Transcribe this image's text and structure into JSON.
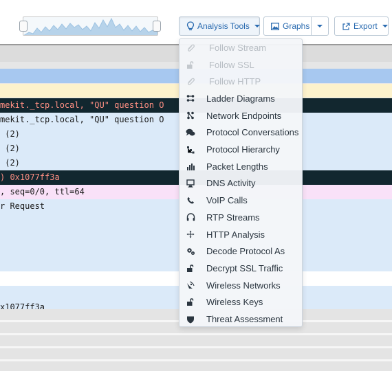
{
  "toolbar": {
    "analysis_label": "Analysis Tools",
    "graphs_label": "Graphs",
    "export_label": "Export"
  },
  "packet_rows": [
    {
      "text": "",
      "bg": "#a7c8f0",
      "color": "#1b1b1b"
    },
    {
      "text": "",
      "bg": "#fdf2cc",
      "color": "#1b1b1b"
    },
    {
      "text": "mekit._tcp.local, \"QU\" question O",
      "bg": "#12272f",
      "color": "#ff8f83"
    },
    {
      "text": "mekit._tcp.local, \"QU\" question O",
      "bg": "#dbeaf9",
      "color": "#1b1b1b"
    },
    {
      "text": " (2)",
      "bg": "#dbeaf9",
      "color": "#1b1b1b"
    },
    {
      "text": " (2)",
      "bg": "#dbeaf9",
      "color": "#1b1b1b"
    },
    {
      "text": " (2)",
      "bg": "#dbeaf9",
      "color": "#1b1b1b"
    },
    {
      "text": ") 0x1077ff3a",
      "bg": "#12272f",
      "color": "#ff8f83"
    },
    {
      "text": ", seq=0/0, ttl=64",
      "bg": "#f9e1f8",
      "color": "#1b1b1b"
    },
    {
      "text": "r Request",
      "bg": "#dbeaf9",
      "color": "#1b1b1b"
    },
    {
      "text": "",
      "bg": "#dbeaf9",
      "color": "#1b1b1b"
    },
    {
      "text": "",
      "bg": "#dbeaf9",
      "color": "#1b1b1b"
    },
    {
      "text": "",
      "bg": "#dbeaf9",
      "color": "#1b1b1b"
    },
    {
      "text": "",
      "bg": "#dbeaf9",
      "color": "#1b1b1b"
    },
    {
      "text": "",
      "bg": "#ffffff",
      "color": "#1b1b1b"
    },
    {
      "text": "",
      "bg": "#dbeaf9",
      "color": "#1b1b1b"
    },
    {
      "text": "x1077ff3a",
      "bg": "#dbeaf9",
      "color": "#1b1b1b"
    }
  ],
  "menu": {
    "items": [
      {
        "label": "Follow Stream",
        "icon": "paperclip-icon",
        "enabled": false
      },
      {
        "label": "Follow SSL",
        "icon": "unlock-icon",
        "enabled": false
      },
      {
        "label": "Follow HTTP",
        "icon": "paperclip-icon",
        "enabled": false
      },
      {
        "label": "Ladder Diagrams",
        "icon": "ladder-icon",
        "enabled": true
      },
      {
        "label": "Network Endpoints",
        "icon": "endpoints-icon",
        "enabled": true
      },
      {
        "label": "Protocol Conversations",
        "icon": "conversations-icon",
        "enabled": true
      },
      {
        "label": "Protocol Hierarchy",
        "icon": "hierarchy-icon",
        "enabled": true
      },
      {
        "label": "Packet Lengths",
        "icon": "bar-chart-icon",
        "enabled": true
      },
      {
        "label": "DNS Activity",
        "icon": "monitor-icon",
        "enabled": true
      },
      {
        "label": "VoIP Calls",
        "icon": "phone-icon",
        "enabled": true
      },
      {
        "label": "RTP Streams",
        "icon": "headphones-icon",
        "enabled": true
      },
      {
        "label": "HTTP Analysis",
        "icon": "move-icon",
        "enabled": true
      },
      {
        "label": "Decode Protocol As",
        "icon": "gears-icon",
        "enabled": true
      },
      {
        "label": "Decrypt SSL Traffic",
        "icon": "unlock-icon",
        "enabled": true
      },
      {
        "label": "Wireless Networks",
        "icon": "satellite-icon",
        "enabled": true
      },
      {
        "label": "Wireless Keys",
        "icon": "unlock-icon",
        "enabled": true
      },
      {
        "label": "Threat Assessment",
        "icon": "shield-icon",
        "enabled": true
      }
    ]
  },
  "colors": {
    "accent": "#2a6bb0",
    "menu_text": "#2b3640",
    "menu_disabled": "#b8bec4"
  }
}
